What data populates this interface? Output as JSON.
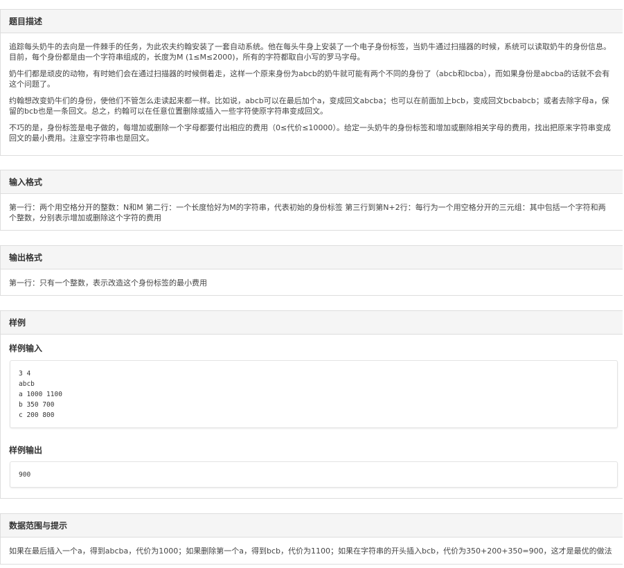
{
  "description": {
    "heading": "题目描述",
    "paragraphs": [
      "追踪每头奶牛的去向是一件棘手的任务，为此农夫约翰安装了一套自动系统。他在每头牛身上安装了一个电子身份标签，当奶牛通过扫描器的时候，系统可以读取奶牛的身份信息。目前，每个身份都是由一个字符串组成的，长度为M (1≤M≤2000)，所有的字符都取自小写的罗马字母。",
      "奶牛们都是顽皮的动物，有时她们会在通过扫描器的时候倒着走，这样一个原来身份为abcb的奶牛就可能有两个不同的身份了（abcb和bcba），而如果身份是abcba的话就不会有这个问题了。",
      "约翰想改变奶牛们的身份，使他们不管怎么走读起来都一样。比如说，abcb可以在最后加个a，变成回文abcba；也可以在前面加上bcb，变成回文bcbabcb；或者去除字母a，保留的bcb也是一条回文。总之，约翰可以在任意位置删除或插入一些字符使原字符串变成回文。",
      "不巧的是，身份标签是电子做的，每增加或删除一个字母都要付出相应的费用（0≤代价≤10000）。给定一头奶牛的身份标签和增加或删除相关字母的费用，找出把原来字符串变成回文的最小费用。注意空字符串也是回文。"
    ]
  },
  "input_format": {
    "heading": "输入格式",
    "text": "第一行：两个用空格分开的整数：N和M 第二行：一个长度恰好为M的字符串，代表初始的身份标签 第三行到第N+2行：每行为一个用空格分开的三元组：其中包括一个字符和两个整数，分别表示增加或删除这个字符的费用"
  },
  "output_format": {
    "heading": "输出格式",
    "text": "第一行：只有一个整数，表示改造这个身份标签的最小费用"
  },
  "sample": {
    "heading": "样例",
    "input_label": "样例输入",
    "input_text": "3 4\nabcb\na 1000 1100\nb 350 700\nc 200 800",
    "output_label": "样例输出",
    "output_text": "900"
  },
  "hint": {
    "heading": "数据范围与提示",
    "text": "如果在最后插入一个a，得到abcba，代价为1000；如果删除第一个a，得到bcb，代价为1100；如果在字符串的开头插入bcb，代价为350+200+350=900，这才是最优的做法"
  }
}
